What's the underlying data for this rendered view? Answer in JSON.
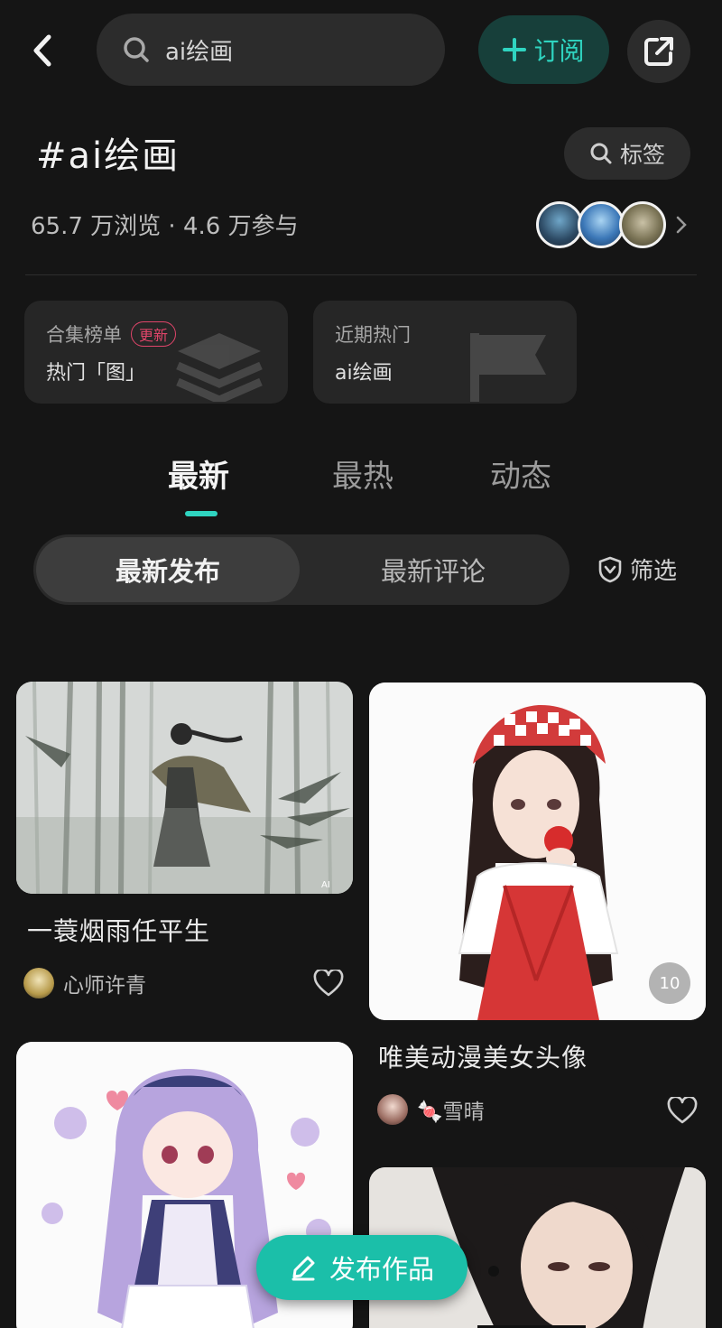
{
  "header": {
    "search_value": "ai绘画",
    "subscribe_label": "订阅",
    "accent_color": "#2fd4c0"
  },
  "topic": {
    "title": "#ai绘画",
    "tag_button": "标签",
    "stats": "65.7 万浏览 · 4.6 万参与"
  },
  "cards": [
    {
      "label": "合集榜单",
      "badge": "更新",
      "value": "热门「图」"
    },
    {
      "label": "近期热门",
      "value": "ai绘画"
    }
  ],
  "tabs": [
    "最新",
    "最热",
    "动态"
  ],
  "segment": {
    "active": "最新发布",
    "other": "最新评论"
  },
  "filter_label": "筛选",
  "posts": [
    {
      "title": "一蓑烟雨任平生",
      "author": "心师许青",
      "image_caption": "AI"
    },
    {
      "title": "唯美动漫美女头像",
      "author": "🍬雪晴",
      "image_count": "10"
    }
  ],
  "publish_button": "发布作品"
}
